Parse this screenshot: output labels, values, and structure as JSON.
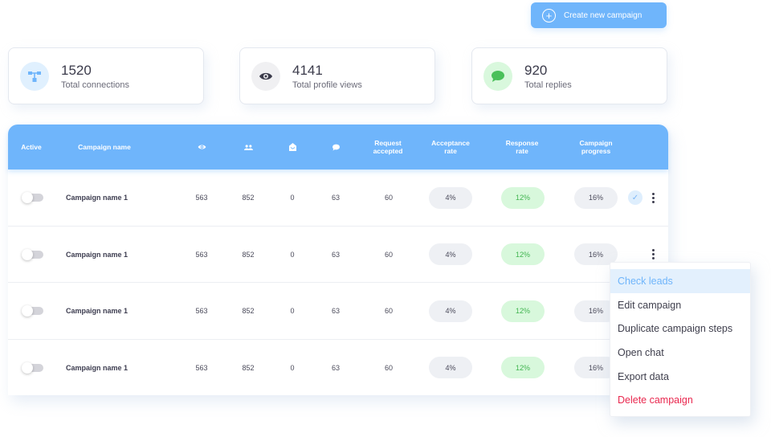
{
  "create_button": {
    "label": "Create new campaign",
    "icon": "plus-circle-icon"
  },
  "stats": [
    {
      "value": "1520",
      "label": "Total connections",
      "icon": "connections-icon",
      "icon_bg": "#e0f0fe",
      "icon_color": "#6fb5fb"
    },
    {
      "value": "4141",
      "label": "Total profile views",
      "icon": "eye-icon",
      "icon_bg": "#f0f0f2",
      "icon_color": "#3a3a4a"
    },
    {
      "value": "920",
      "label": "Total replies",
      "icon": "chat-bubble-icon",
      "icon_bg": "#d9f8dd",
      "icon_color": "#4ac05a"
    }
  ],
  "table": {
    "headers": {
      "active": "Active",
      "campaign_name": "Campaign name",
      "views_icon": "eye-icon",
      "connections_icon": "people-icon",
      "messages_icon": "open-envelope-icon",
      "replies_icon": "chat-bubble-icon",
      "request_accepted_1": "Request",
      "request_accepted_2": "accepted",
      "acceptance_rate_1": "Acceptance",
      "acceptance_rate_2": "rate",
      "response_rate_1": "Response",
      "response_rate_2": "rate",
      "campaign_progress_1": "Campaign",
      "campaign_progress_2": "progress"
    },
    "rows": [
      {
        "active": false,
        "name": "Campaign name 1",
        "views": "563",
        "connections": "852",
        "messages": "0",
        "replies": "63",
        "request_accepted": "60",
        "acceptance_rate": "4%",
        "response_rate": "12%",
        "progress": "16%",
        "checked": true
      },
      {
        "active": false,
        "name": "Campaign name 1",
        "views": "563",
        "connections": "852",
        "messages": "0",
        "replies": "63",
        "request_accepted": "60",
        "acceptance_rate": "4%",
        "response_rate": "12%",
        "progress": "16%",
        "checked": false
      },
      {
        "active": false,
        "name": "Campaign name 1",
        "views": "563",
        "connections": "852",
        "messages": "0",
        "replies": "63",
        "request_accepted": "60",
        "acceptance_rate": "4%",
        "response_rate": "12%",
        "progress": "16%",
        "checked": false
      },
      {
        "active": false,
        "name": "Campaign name 1",
        "views": "563",
        "connections": "852",
        "messages": "0",
        "replies": "63",
        "request_accepted": "60",
        "acceptance_rate": "4%",
        "response_rate": "12%",
        "progress": "16%",
        "checked": false
      }
    ]
  },
  "context_menu": {
    "items": [
      {
        "label": "Check leads",
        "state": "hover"
      },
      {
        "label": "Edit campaign",
        "state": "normal"
      },
      {
        "label": "Duplicate campaign steps",
        "state": "normal"
      },
      {
        "label": "Open chat",
        "state": "normal"
      },
      {
        "label": "Export data",
        "state": "normal"
      },
      {
        "label": "Delete campaign",
        "state": "danger"
      }
    ]
  },
  "colors": {
    "accent": "#6fb5fb",
    "success": "#41b550",
    "danger": "#e9284f"
  }
}
